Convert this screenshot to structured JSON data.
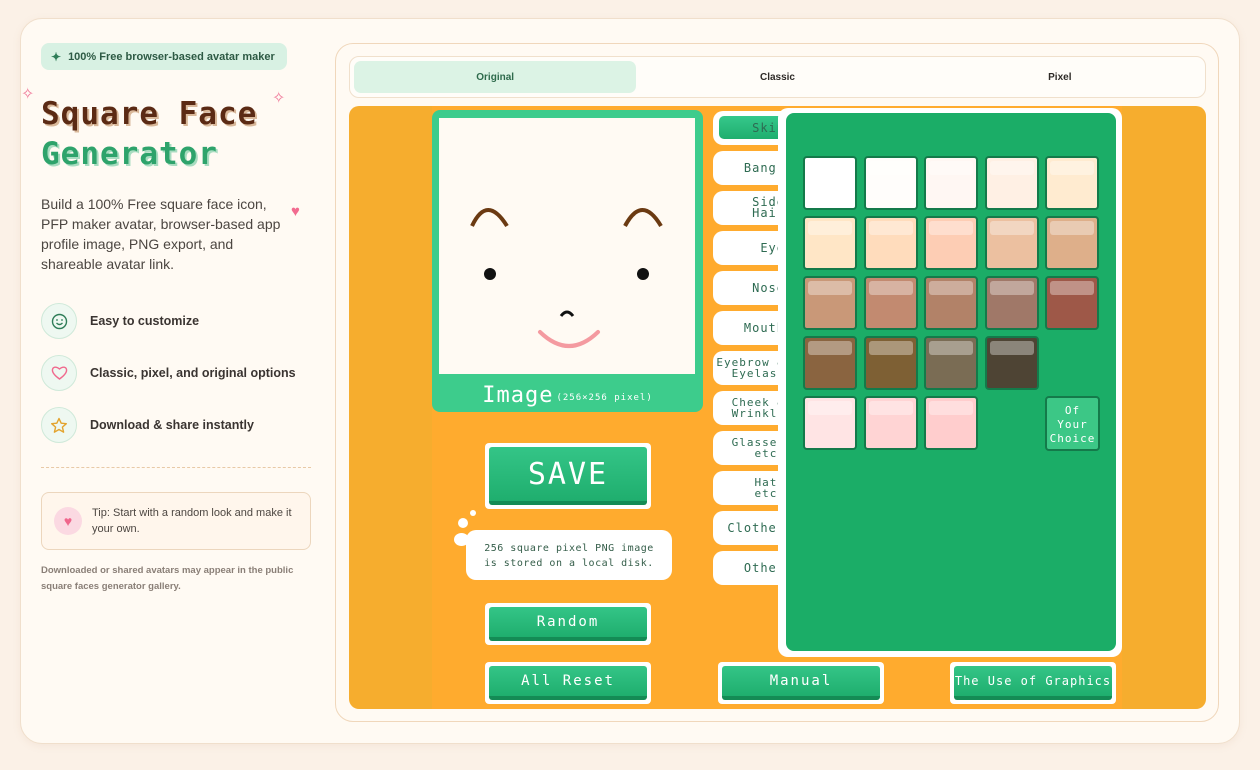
{
  "badge": {
    "text": "100% Free browser-based avatar maker",
    "icon": "sparkle-icon"
  },
  "title": {
    "line1": "Square Face",
    "line2": "Generator"
  },
  "description": "Build a 100% Free square face icon, PFP maker avatar, browser-based app profile image, PNG export, and shareable avatar link.",
  "features": [
    {
      "label": "Easy to customize",
      "icon": "smiley-icon"
    },
    {
      "label": "Classic, pixel, and original options",
      "icon": "heart-icon"
    },
    {
      "label": "Download & share instantly",
      "icon": "star-icon"
    }
  ],
  "tip": "Tip: Start with a random look and make it your own.",
  "fineprint": "Downloaded or shared avatars may appear in the public square faces generator gallery.",
  "tabs": [
    "Original",
    "Classic",
    "Pixel"
  ],
  "active_tab": "Original",
  "image_label": {
    "big": "Image",
    "small": "(256×256 pixel)"
  },
  "buttons": {
    "save": "SAVE",
    "random": "Random",
    "all_reset": "All Reset",
    "manual": "Manual",
    "use_of_graphics": "The Use of Graphics"
  },
  "bubble_text": {
    "line1": "256 square pixel PNG image",
    "line2": "is stored on a local disk."
  },
  "categories": [
    {
      "line1": "Skin",
      "line2": ""
    },
    {
      "line1": "Bangs",
      "line2": ""
    },
    {
      "line1": "Side Hair",
      "line2": ""
    },
    {
      "line1": "Eye",
      "line2": ""
    },
    {
      "line1": "Nose",
      "line2": ""
    },
    {
      "line1": "Mouth",
      "line2": ""
    },
    {
      "line1": "Eyebrow &",
      "line2": "Eyelash"
    },
    {
      "line1": "Cheek &",
      "line2": "Wrinkle"
    },
    {
      "line1": "Glasses",
      "line2": "etc."
    },
    {
      "line1": "Hats",
      "line2": "etc."
    },
    {
      "line1": "Clothes",
      "line2": ""
    },
    {
      "line1": "Other",
      "line2": ""
    }
  ],
  "active_category": "Skin",
  "skin_swatches": [
    [
      "#ffffff",
      "#fffdfb",
      "#fff7f3",
      "#fff0e4",
      "#ffebd0"
    ],
    [
      "#ffe6c6",
      "#ffdcbc",
      "#fdcdb4",
      "#ecc0a0",
      "#deaf8a"
    ],
    [
      "#c99878",
      "#c28a70",
      "#b28268",
      "#a07868",
      "#9e5848"
    ],
    [
      "#8a6440",
      "#7e6034",
      "#7a6c54",
      "#4e4434",
      null
    ],
    [
      "#ffe4e4",
      "#ffd4d4",
      "#ffcdcd",
      null,
      null
    ]
  ],
  "choice_label": {
    "line1": "Of",
    "line2": "Your",
    "line3": "Choice"
  },
  "colors": {
    "accent_green": "#1bad67",
    "stage_orange": "#f6ad2e",
    "brand_brown": "#5b2a14"
  }
}
